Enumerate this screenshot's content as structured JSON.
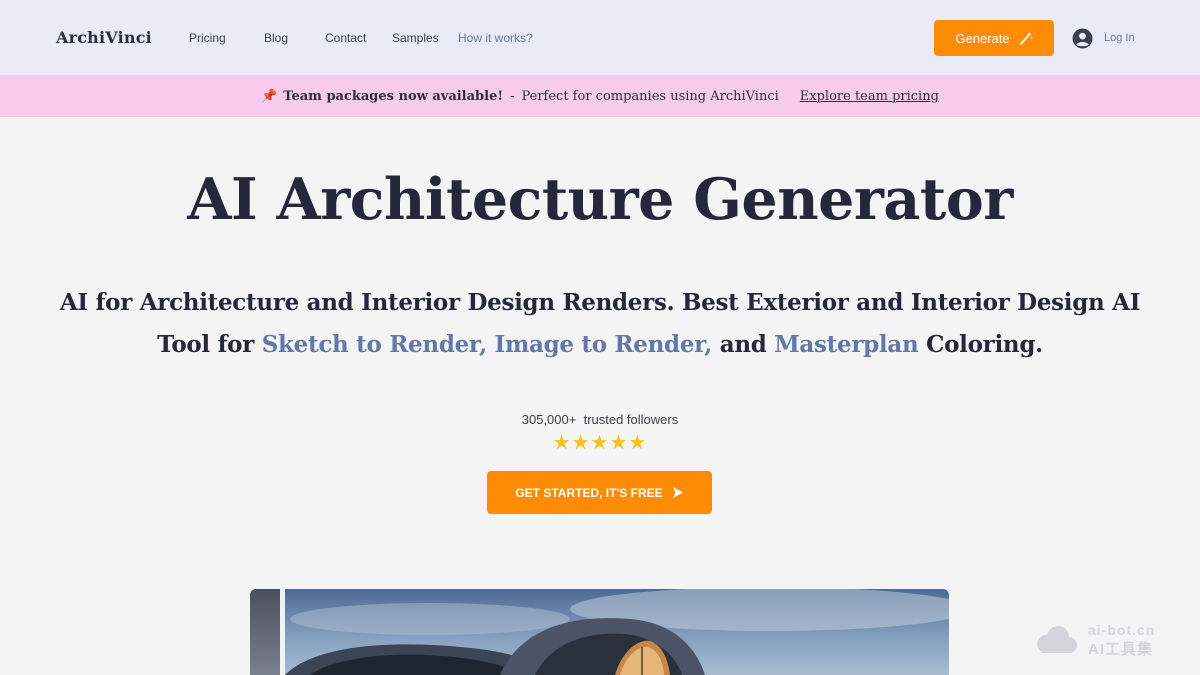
{
  "header": {
    "logo": "ArchiVinci",
    "nav": [
      "Pricing",
      "Blog",
      "Contact",
      "Samples",
      "How it works?"
    ],
    "generate_label": "Generate",
    "login_label": "Log In"
  },
  "banner": {
    "pin_icon": "pushpin-icon",
    "headline": "Team packages now available!",
    "separator": "-",
    "text": "Perfect for companies using ArchiVinci",
    "link": "Explore team pricing"
  },
  "hero": {
    "title": "AI Architecture Generator",
    "subtitle_part1": "AI for Architecture and Interior Design Renders. Best Exterior and Interior Design AI Tool for ",
    "subtitle_highlight1": "Sketch to Render, Image to Render,",
    "subtitle_part2": " and ",
    "subtitle_highlight2": "Masterplan",
    "subtitle_part3": " Coloring.",
    "followers_count": "305,000+",
    "followers_label": "trusted followers",
    "rating_stars": "★★★★★",
    "rating": 5,
    "cta_label": "GET STARTED, IT'S FREE"
  },
  "watermark": {
    "line1": "ai-bot.cn",
    "line2": "AI工具集"
  },
  "colors": {
    "accent": "#fd8c04",
    "header_bg": "#e9ecf6",
    "banner_bg": "#f6cbeb",
    "highlight": "#6478a8",
    "star": "#f9c11e"
  }
}
